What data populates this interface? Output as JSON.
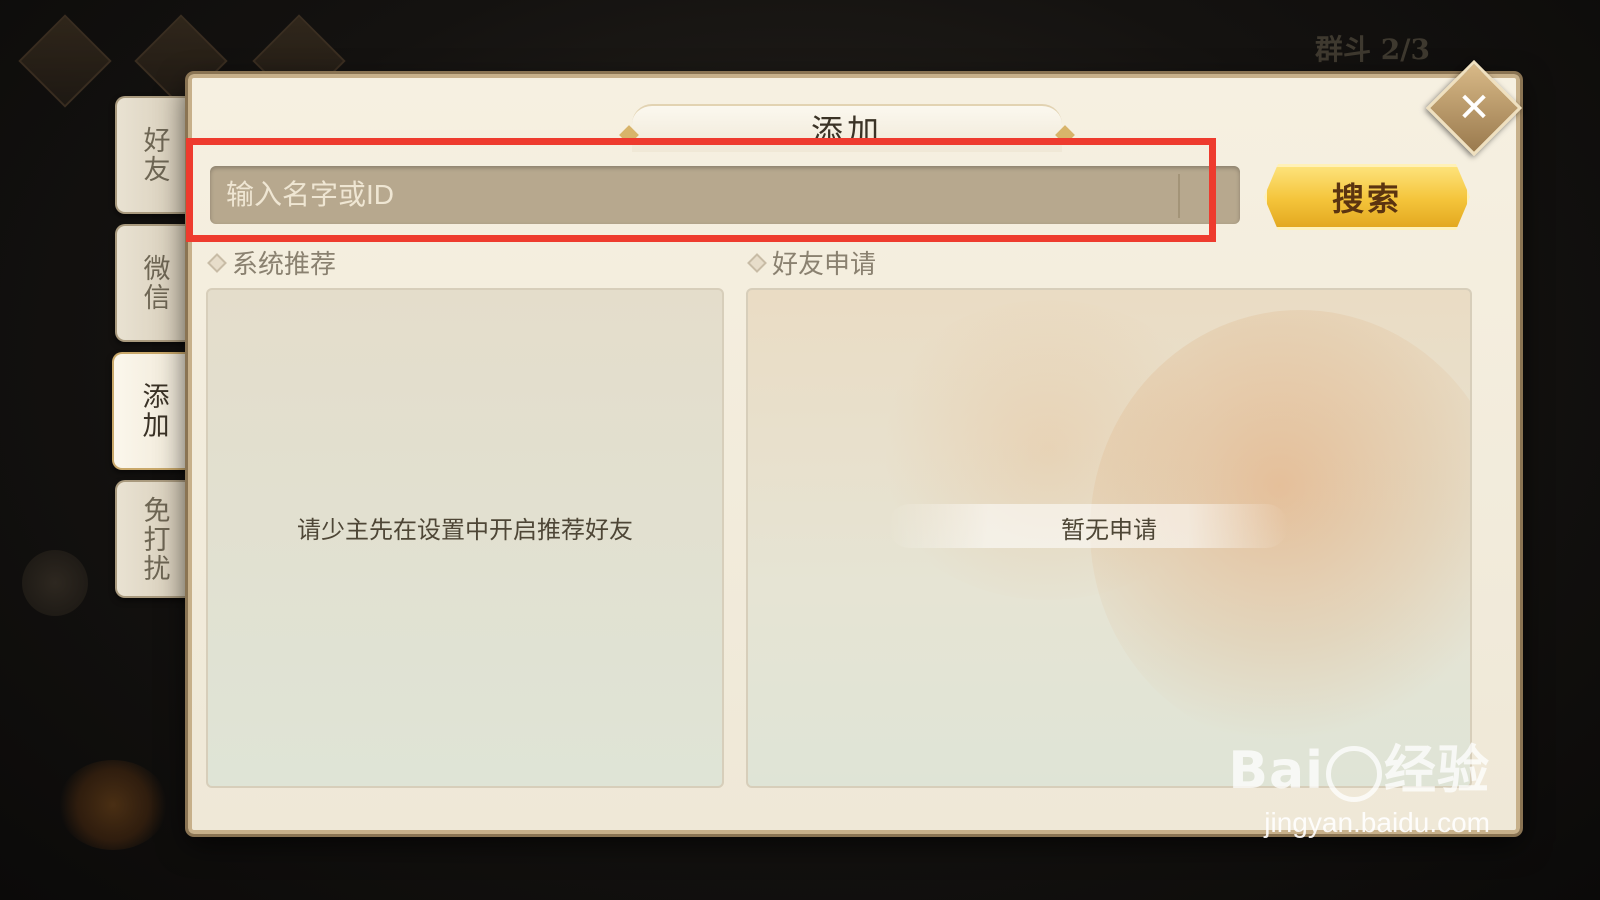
{
  "tabs": [
    {
      "label": "好友",
      "active": false
    },
    {
      "label": "微信",
      "active": false
    },
    {
      "label": "添加",
      "active": true
    },
    {
      "label": "免打扰",
      "active": false
    }
  ],
  "panel": {
    "title": "添加",
    "search": {
      "placeholder": "输入名字或ID",
      "value": "",
      "button_label": "搜索"
    },
    "recommend": {
      "header": "系统推荐",
      "message": "请少主先在设置中开启推荐好友"
    },
    "requests": {
      "header": "好友申请",
      "message": "暂无申请"
    }
  },
  "background": {
    "top_right_text": "群斗 2/3"
  },
  "watermark": {
    "logo_text_left": "Bai",
    "logo_text_right": "经验",
    "url": "jingyan.baidu.com"
  },
  "colors": {
    "highlight": "#ee3b2e",
    "search_button": "#f4c43a",
    "panel_bg": "#f6f0e1",
    "input_bg": "#b7a88e"
  },
  "icons": {
    "close": "close-icon"
  }
}
